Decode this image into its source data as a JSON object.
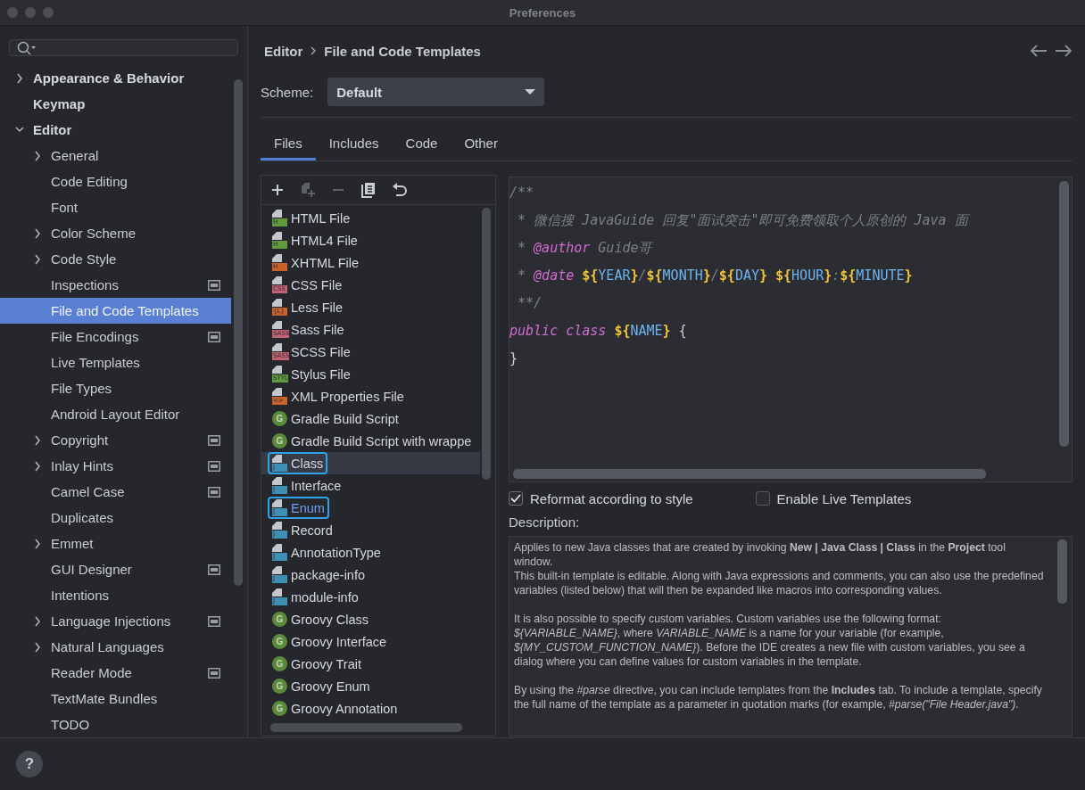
{
  "window": {
    "title": "Preferences"
  },
  "sidebar": {
    "items": [
      {
        "label": "Appearance & Behavior",
        "expanded": false
      },
      {
        "label": "Keymap"
      },
      {
        "label": "Editor",
        "expanded": true,
        "children": [
          {
            "label": "General",
            "expanded": false,
            "selected": false
          },
          {
            "label": "Code Editing",
            "selected": false
          },
          {
            "label": "Font",
            "selected": false
          },
          {
            "label": "Color Scheme",
            "expanded": false,
            "selected": false
          },
          {
            "label": "Code Style",
            "expanded": false,
            "selected": false
          },
          {
            "label": "Inspections",
            "project_scoped": true,
            "selected": false
          },
          {
            "label": "File and Code Templates",
            "selected": true
          },
          {
            "label": "File Encodings",
            "project_scoped": true,
            "selected": false
          },
          {
            "label": "Live Templates",
            "selected": false
          },
          {
            "label": "File Types",
            "selected": false
          },
          {
            "label": "Android Layout Editor",
            "selected": false
          },
          {
            "label": "Copyright",
            "expanded": false,
            "project_scoped": true,
            "selected": false
          },
          {
            "label": "Inlay Hints",
            "expanded": false,
            "project_scoped": true,
            "selected": false
          },
          {
            "label": "Camel Case",
            "project_scoped": true,
            "selected": false
          },
          {
            "label": "Duplicates",
            "selected": false
          },
          {
            "label": "Emmet",
            "expanded": false,
            "selected": false
          },
          {
            "label": "GUI Designer",
            "project_scoped": true,
            "selected": false
          },
          {
            "label": "Intentions",
            "selected": false
          },
          {
            "label": "Language Injections",
            "expanded": false,
            "project_scoped": true,
            "selected": false
          },
          {
            "label": "Natural Languages",
            "expanded": false,
            "selected": false
          },
          {
            "label": "Reader Mode",
            "project_scoped": true,
            "selected": false
          },
          {
            "label": "TextMate Bundles",
            "selected": false
          },
          {
            "label": "TODO",
            "selected": false
          }
        ]
      }
    ]
  },
  "breadcrumb": [
    "Editor",
    "File and Code Templates"
  ],
  "scheme": {
    "label": "Scheme:",
    "value": "Default"
  },
  "tabs": [
    {
      "label": "Files",
      "selected": true
    },
    {
      "label": "Includes",
      "selected": false
    },
    {
      "label": "Code",
      "selected": false
    },
    {
      "label": "Other",
      "selected": false
    }
  ],
  "toolbar": [
    {
      "kind": "add",
      "disabled": false
    },
    {
      "kind": "add-file",
      "disabled": true
    },
    {
      "kind": "remove",
      "disabled": true
    },
    {
      "kind": "copy",
      "disabled": false
    },
    {
      "kind": "reset",
      "disabled": false
    }
  ],
  "templates": [
    {
      "name": "HTML File",
      "kind": "file",
      "badge": "H",
      "color": "#5f9a3c",
      "selected": false,
      "outlined": false,
      "modified": false
    },
    {
      "name": "HTML4 File",
      "kind": "file",
      "badge": "H",
      "color": "#5f9a3c",
      "selected": false,
      "outlined": false,
      "modified": false
    },
    {
      "name": "XHTML File",
      "kind": "file",
      "badge": "H",
      "color": "#c9612a",
      "selected": false,
      "outlined": false,
      "modified": false
    },
    {
      "name": "CSS File",
      "kind": "file",
      "badge": "CSS",
      "color": "#c46172",
      "selected": false,
      "outlined": false,
      "modified": false
    },
    {
      "name": "Less File",
      "kind": "file",
      "badge": "{L}",
      "color": "#c9612a",
      "selected": false,
      "outlined": false,
      "modified": false
    },
    {
      "name": "Sass File",
      "kind": "file",
      "badge": "SASS",
      "color": "#c46172",
      "selected": false,
      "outlined": false,
      "modified": false
    },
    {
      "name": "SCSS File",
      "kind": "file",
      "badge": "SASS",
      "color": "#c46172",
      "selected": false,
      "outlined": false,
      "modified": false
    },
    {
      "name": "Stylus File",
      "kind": "file",
      "badge": "STYL",
      "color": "#5f9a3c",
      "selected": false,
      "outlined": false,
      "modified": false
    },
    {
      "name": "XML Properties File",
      "kind": "file",
      "badge": "<>",
      "color": "#c9612a",
      "selected": false,
      "outlined": false,
      "modified": false
    },
    {
      "name": "Gradle Build Script",
      "kind": "round",
      "badge": "G",
      "color": "#5b8a3a",
      "selected": false,
      "outlined": false,
      "modified": false
    },
    {
      "name": "Gradle Build Script with wrappe",
      "kind": "round",
      "badge": "G",
      "color": "#5b8a3a",
      "selected": false,
      "outlined": false,
      "modified": false
    },
    {
      "name": "Class",
      "kind": "file",
      "badge": "J",
      "color": "#3f8fb5",
      "selected": true,
      "outlined": true,
      "modified": false
    },
    {
      "name": "Interface",
      "kind": "file",
      "badge": "J",
      "color": "#3f8fb5",
      "selected": false,
      "outlined": false,
      "modified": false
    },
    {
      "name": "Enum",
      "kind": "file",
      "badge": "J",
      "color": "#3f8fb5",
      "selected": false,
      "outlined": true,
      "modified": true
    },
    {
      "name": "Record",
      "kind": "file",
      "badge": "J",
      "color": "#3f8fb5",
      "selected": false,
      "outlined": false,
      "modified": false
    },
    {
      "name": "AnnotationType",
      "kind": "file",
      "badge": "J",
      "color": "#3f8fb5",
      "selected": false,
      "outlined": false,
      "modified": false
    },
    {
      "name": "package-info",
      "kind": "file",
      "badge": "J",
      "color": "#3f8fb5",
      "selected": false,
      "outlined": false,
      "modified": false
    },
    {
      "name": "module-info",
      "kind": "file",
      "badge": "J",
      "color": "#3f8fb5",
      "selected": false,
      "outlined": false,
      "modified": false
    },
    {
      "name": "Groovy Class",
      "kind": "round",
      "badge": "G",
      "color": "#5b8a3a",
      "selected": false,
      "outlined": false,
      "modified": false
    },
    {
      "name": "Groovy Interface",
      "kind": "round",
      "badge": "G",
      "color": "#5b8a3a",
      "selected": false,
      "outlined": false,
      "modified": false
    },
    {
      "name": "Groovy Trait",
      "kind": "round",
      "badge": "G",
      "color": "#5b8a3a",
      "selected": false,
      "outlined": false,
      "modified": false
    },
    {
      "name": "Groovy Enum",
      "kind": "round",
      "badge": "G",
      "color": "#5b8a3a",
      "selected": false,
      "outlined": false,
      "modified": false
    },
    {
      "name": "Groovy Annotation",
      "kind": "round",
      "badge": "G",
      "color": "#5b8a3a",
      "selected": false,
      "outlined": false,
      "modified": false
    }
  ],
  "code": [
    [
      {
        "t": "/**",
        "kind": "comment"
      }
    ],
    [
      {
        "t": " * 微信搜 JavaGuide 回复\"面试突击\"即可免费领取个人原创的 Java 面",
        "kind": "comment"
      }
    ],
    [
      {
        "t": " * ",
        "kind": "comment"
      },
      {
        "t": "@author",
        "kind": "tag"
      },
      {
        "t": " Guide哥",
        "kind": "comment"
      }
    ],
    [
      {
        "t": " * ",
        "kind": "comment"
      },
      {
        "t": "@date ",
        "kind": "tag"
      },
      {
        "t": "${",
        "kind": "brace"
      },
      {
        "t": "YEAR",
        "kind": "var"
      },
      {
        "t": "}",
        "kind": "brace"
      },
      {
        "t": "/",
        "kind": "comment"
      },
      {
        "t": "${",
        "kind": "brace"
      },
      {
        "t": "MONTH",
        "kind": "var"
      },
      {
        "t": "}",
        "kind": "brace"
      },
      {
        "t": "/",
        "kind": "comment"
      },
      {
        "t": "${",
        "kind": "brace"
      },
      {
        "t": "DAY",
        "kind": "var"
      },
      {
        "t": "} ${",
        "kind": "brace"
      },
      {
        "t": "HOUR",
        "kind": "var"
      },
      {
        "t": "}",
        "kind": "brace"
      },
      {
        "t": ":",
        "kind": "comment"
      },
      {
        "t": "${",
        "kind": "brace"
      },
      {
        "t": "MINUTE",
        "kind": "var"
      },
      {
        "t": "}",
        "kind": "brace"
      }
    ],
    [
      {
        "t": " **/",
        "kind": "comment"
      }
    ],
    [
      {
        "t": "public ",
        "kind": "keyword"
      },
      {
        "t": "class ",
        "kind": "keyword"
      },
      {
        "t": "${",
        "kind": "brace"
      },
      {
        "t": "NAME",
        "kind": "var"
      },
      {
        "t": "}",
        "kind": "brace"
      },
      {
        "t": " {",
        "kind": "plain"
      }
    ],
    [
      {
        "t": "}",
        "kind": "plain"
      }
    ]
  ],
  "options": [
    {
      "label": "Reformat according to style",
      "checked": true
    },
    {
      "label": "Enable Live Templates",
      "checked": false
    }
  ],
  "description": {
    "label": "Description:",
    "paragraphs": [
      [
        "Applies to new Java classes that are created by invoking **New | Java Class | Class** in the **Project** tool window.",
        "This built-in template is editable. Along with Java expressions and comments, you can also use the predefined variables (listed below) that will then be expanded like macros into corresponding values."
      ],
      [
        "It is also possible to specify custom variables. Custom variables use the following format: *${VARIABLE_NAME}*, where *VARIABLE_NAME* is a name for your variable (for example, *${MY_CUSTOM_FUNCTION_NAME}*). Before the IDE creates a new file with custom variables, you see a dialog where you can define values for custom variables in the template."
      ],
      [
        "By using the *#parse* directive, you can include templates from the **Includes** tab. To include a template, specify the full name of the template as a parameter in quotation marks (for example, *#parse(\"File Header.java\")*."
      ]
    ]
  },
  "help": "?"
}
